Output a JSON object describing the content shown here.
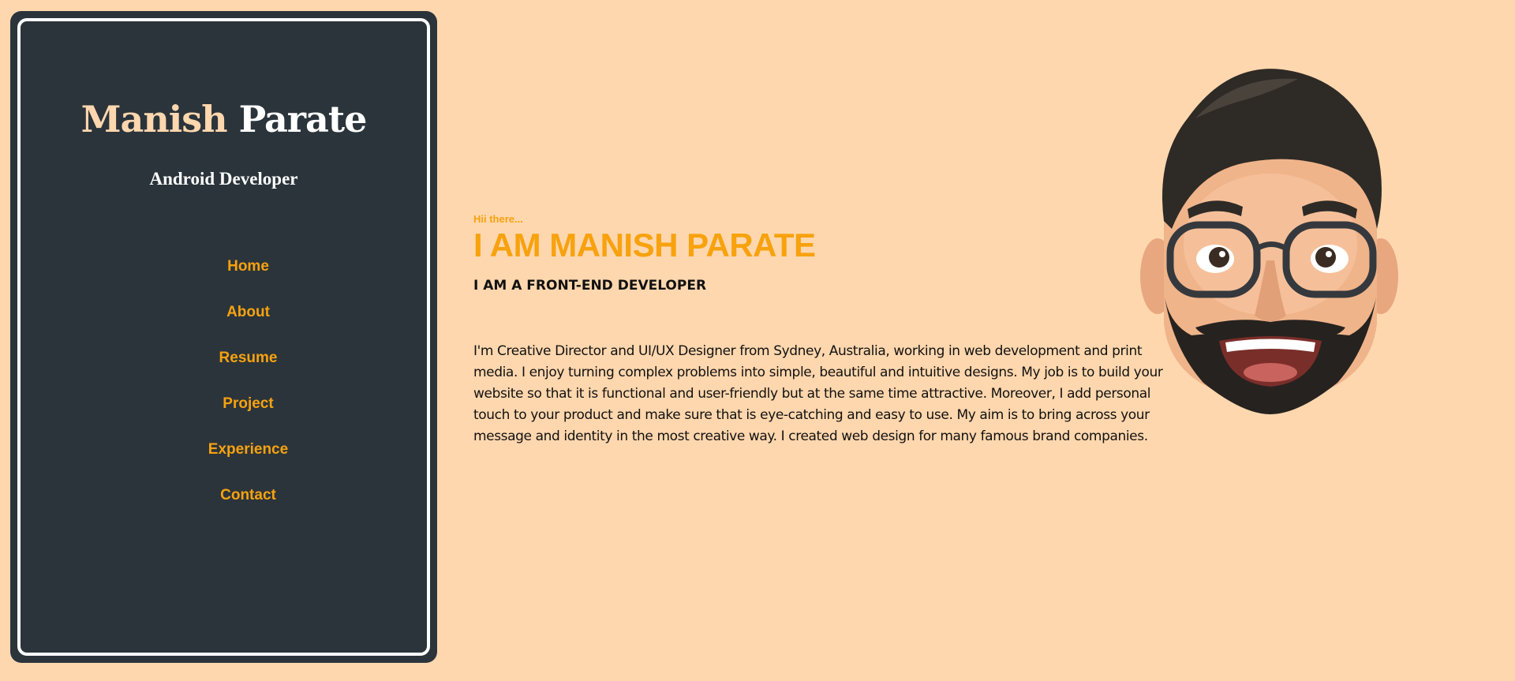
{
  "sidebar": {
    "first_name": "Manish",
    "last_name": "Parate",
    "role": "Android Developer",
    "nav": [
      "Home",
      "About",
      "Resume",
      "Project",
      "Experience",
      "Contact"
    ]
  },
  "hero": {
    "greeting": "Hii there...",
    "headline": "I AM MANISH PARATE",
    "subtitle": "I AM A FRONT-END DEVELOPER",
    "bio": "I'm Creative Director and UI/UX Designer from Sydney, Australia, working in web development and print media. I enjoy turning complex problems into simple, beautiful and intuitive designs. My job is to build your website so that it is functional and user-friendly but at the same time attractive. Moreover, I add personal touch to your product and make sure that is eye-catching and easy to use. My aim is to bring across your message and identity in the most creative way. I created web design for many famous brand companies."
  },
  "colors": {
    "background": "#FFD7AE",
    "sidebar": "#2B343B",
    "accent": "#F7A20E"
  },
  "avatar": {
    "icon": "memoji-avatar-icon"
  }
}
